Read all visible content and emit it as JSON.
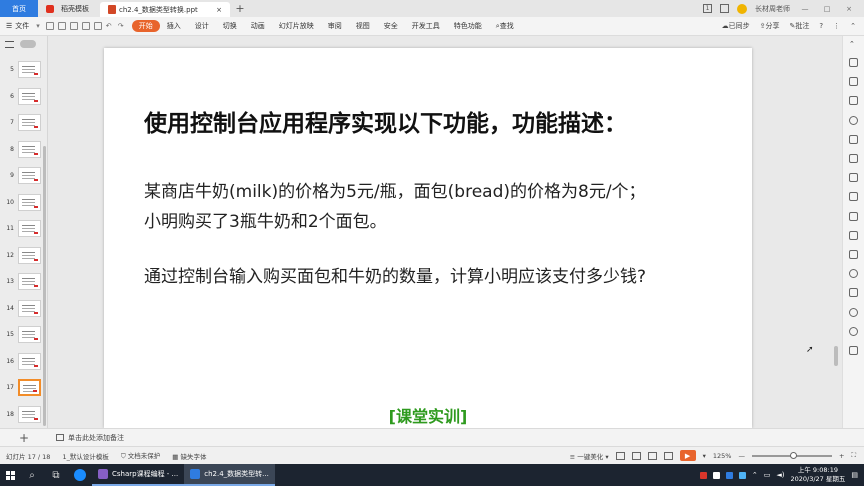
{
  "titlebar": {
    "home_tab": "首页",
    "template_tab": "稻壳模板",
    "doc_tab": "ch2.4_数据类型转换.ppt",
    "close": "×",
    "add": "+",
    "page_badge": "1",
    "user": "长材周老师",
    "min": "—",
    "max": "□",
    "win_close": "×"
  },
  "menubar": {
    "file": "文件",
    "items": [
      "开始",
      "插入",
      "设计",
      "切换",
      "动画",
      "幻灯片放映",
      "审阅",
      "视图",
      "安全",
      "开发工具",
      "特色功能"
    ],
    "search": "查找",
    "sync": "已同步",
    "share": "分享",
    "comment": "批注",
    "help": "?"
  },
  "thumbnails": {
    "numbers": [
      "5",
      "6",
      "7",
      "8",
      "9",
      "10",
      "11",
      "12",
      "13",
      "14",
      "15",
      "16",
      "17",
      "18"
    ],
    "current": "17"
  },
  "slide": {
    "title": "使用控制台应用程序实现以下功能，功能描述：",
    "line1": "某商店牛奶(milk)的价格为5元/瓶，面包(bread)的价格为8元/个；",
    "line2": "小明购买了3瓶牛奶和2个面包。",
    "line3": "通过控制台输入购买面包和牛奶的数量，计算小明应该支付多少钱?",
    "footer": "[课堂实训]"
  },
  "notes": {
    "add_button": "+",
    "placeholder": "单击此处添加备注"
  },
  "statusbar": {
    "slide_info": "幻灯片 17 / 18",
    "template": "1_默认设计模板",
    "protection": "文档未保护",
    "missing_font": "缺失字体",
    "beautify": "一键美化",
    "zoom": "125%",
    "zoom_minus": "—",
    "zoom_plus": "+"
  },
  "taskbar": {
    "app1": "Csharp课程编程 - ...",
    "app2": "ch2.4_数据类型转...",
    "time": "上午 9:08:19",
    "date": "2020/3/27 星期五"
  },
  "colors": {
    "accent": "#e8642c",
    "home_tab": "#2f7ce0",
    "footer_green": "#2e9a1e",
    "current_thumb": "#f28c28"
  }
}
